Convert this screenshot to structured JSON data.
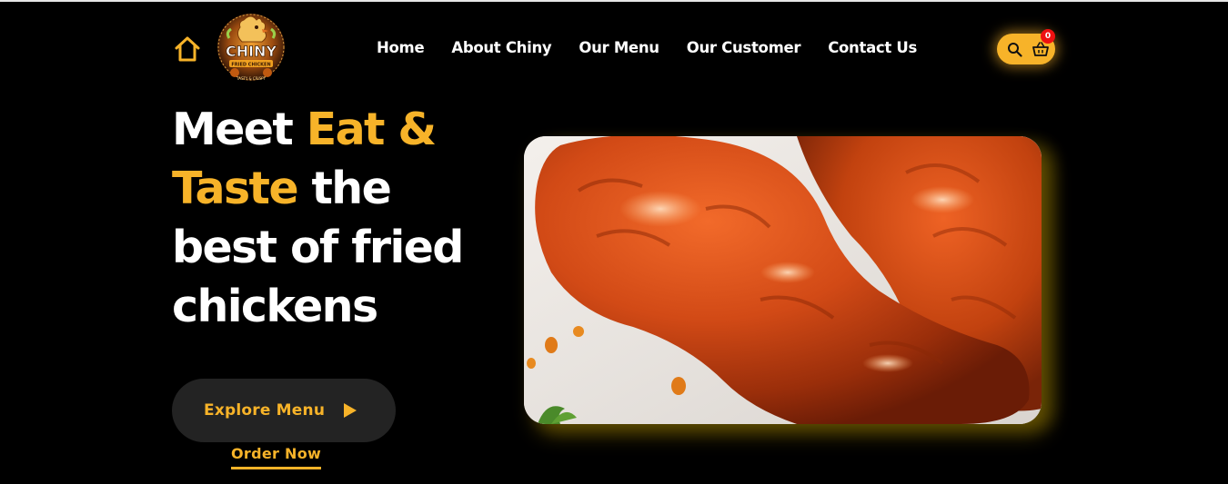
{
  "header": {
    "logo": {
      "brand": "CHINY",
      "ribbon": "FRIED CHICKEN",
      "tagline": "TASTY & CRISPY"
    },
    "nav": [
      {
        "label": "Home"
      },
      {
        "label": "About Chiny"
      },
      {
        "label": "Our Menu"
      },
      {
        "label": "Our Customer"
      },
      {
        "label": "Contact Us"
      }
    ],
    "cart_count": "0"
  },
  "hero": {
    "headline": {
      "line1_plain": "Meet ",
      "line1_accent": "Eat &",
      "line2_accent": "Taste",
      "line2_plain": " the",
      "line3": "best of fried",
      "line4": "chickens"
    },
    "explore_label": "Explore Menu",
    "order_label": "Order Now"
  },
  "colors": {
    "accent": "#f7b329",
    "background": "#000000",
    "button_bg": "#232323",
    "badge": "#ee1111"
  },
  "icons": [
    "home-icon",
    "logo-emblem",
    "search-icon",
    "basket-icon",
    "play-icon"
  ]
}
